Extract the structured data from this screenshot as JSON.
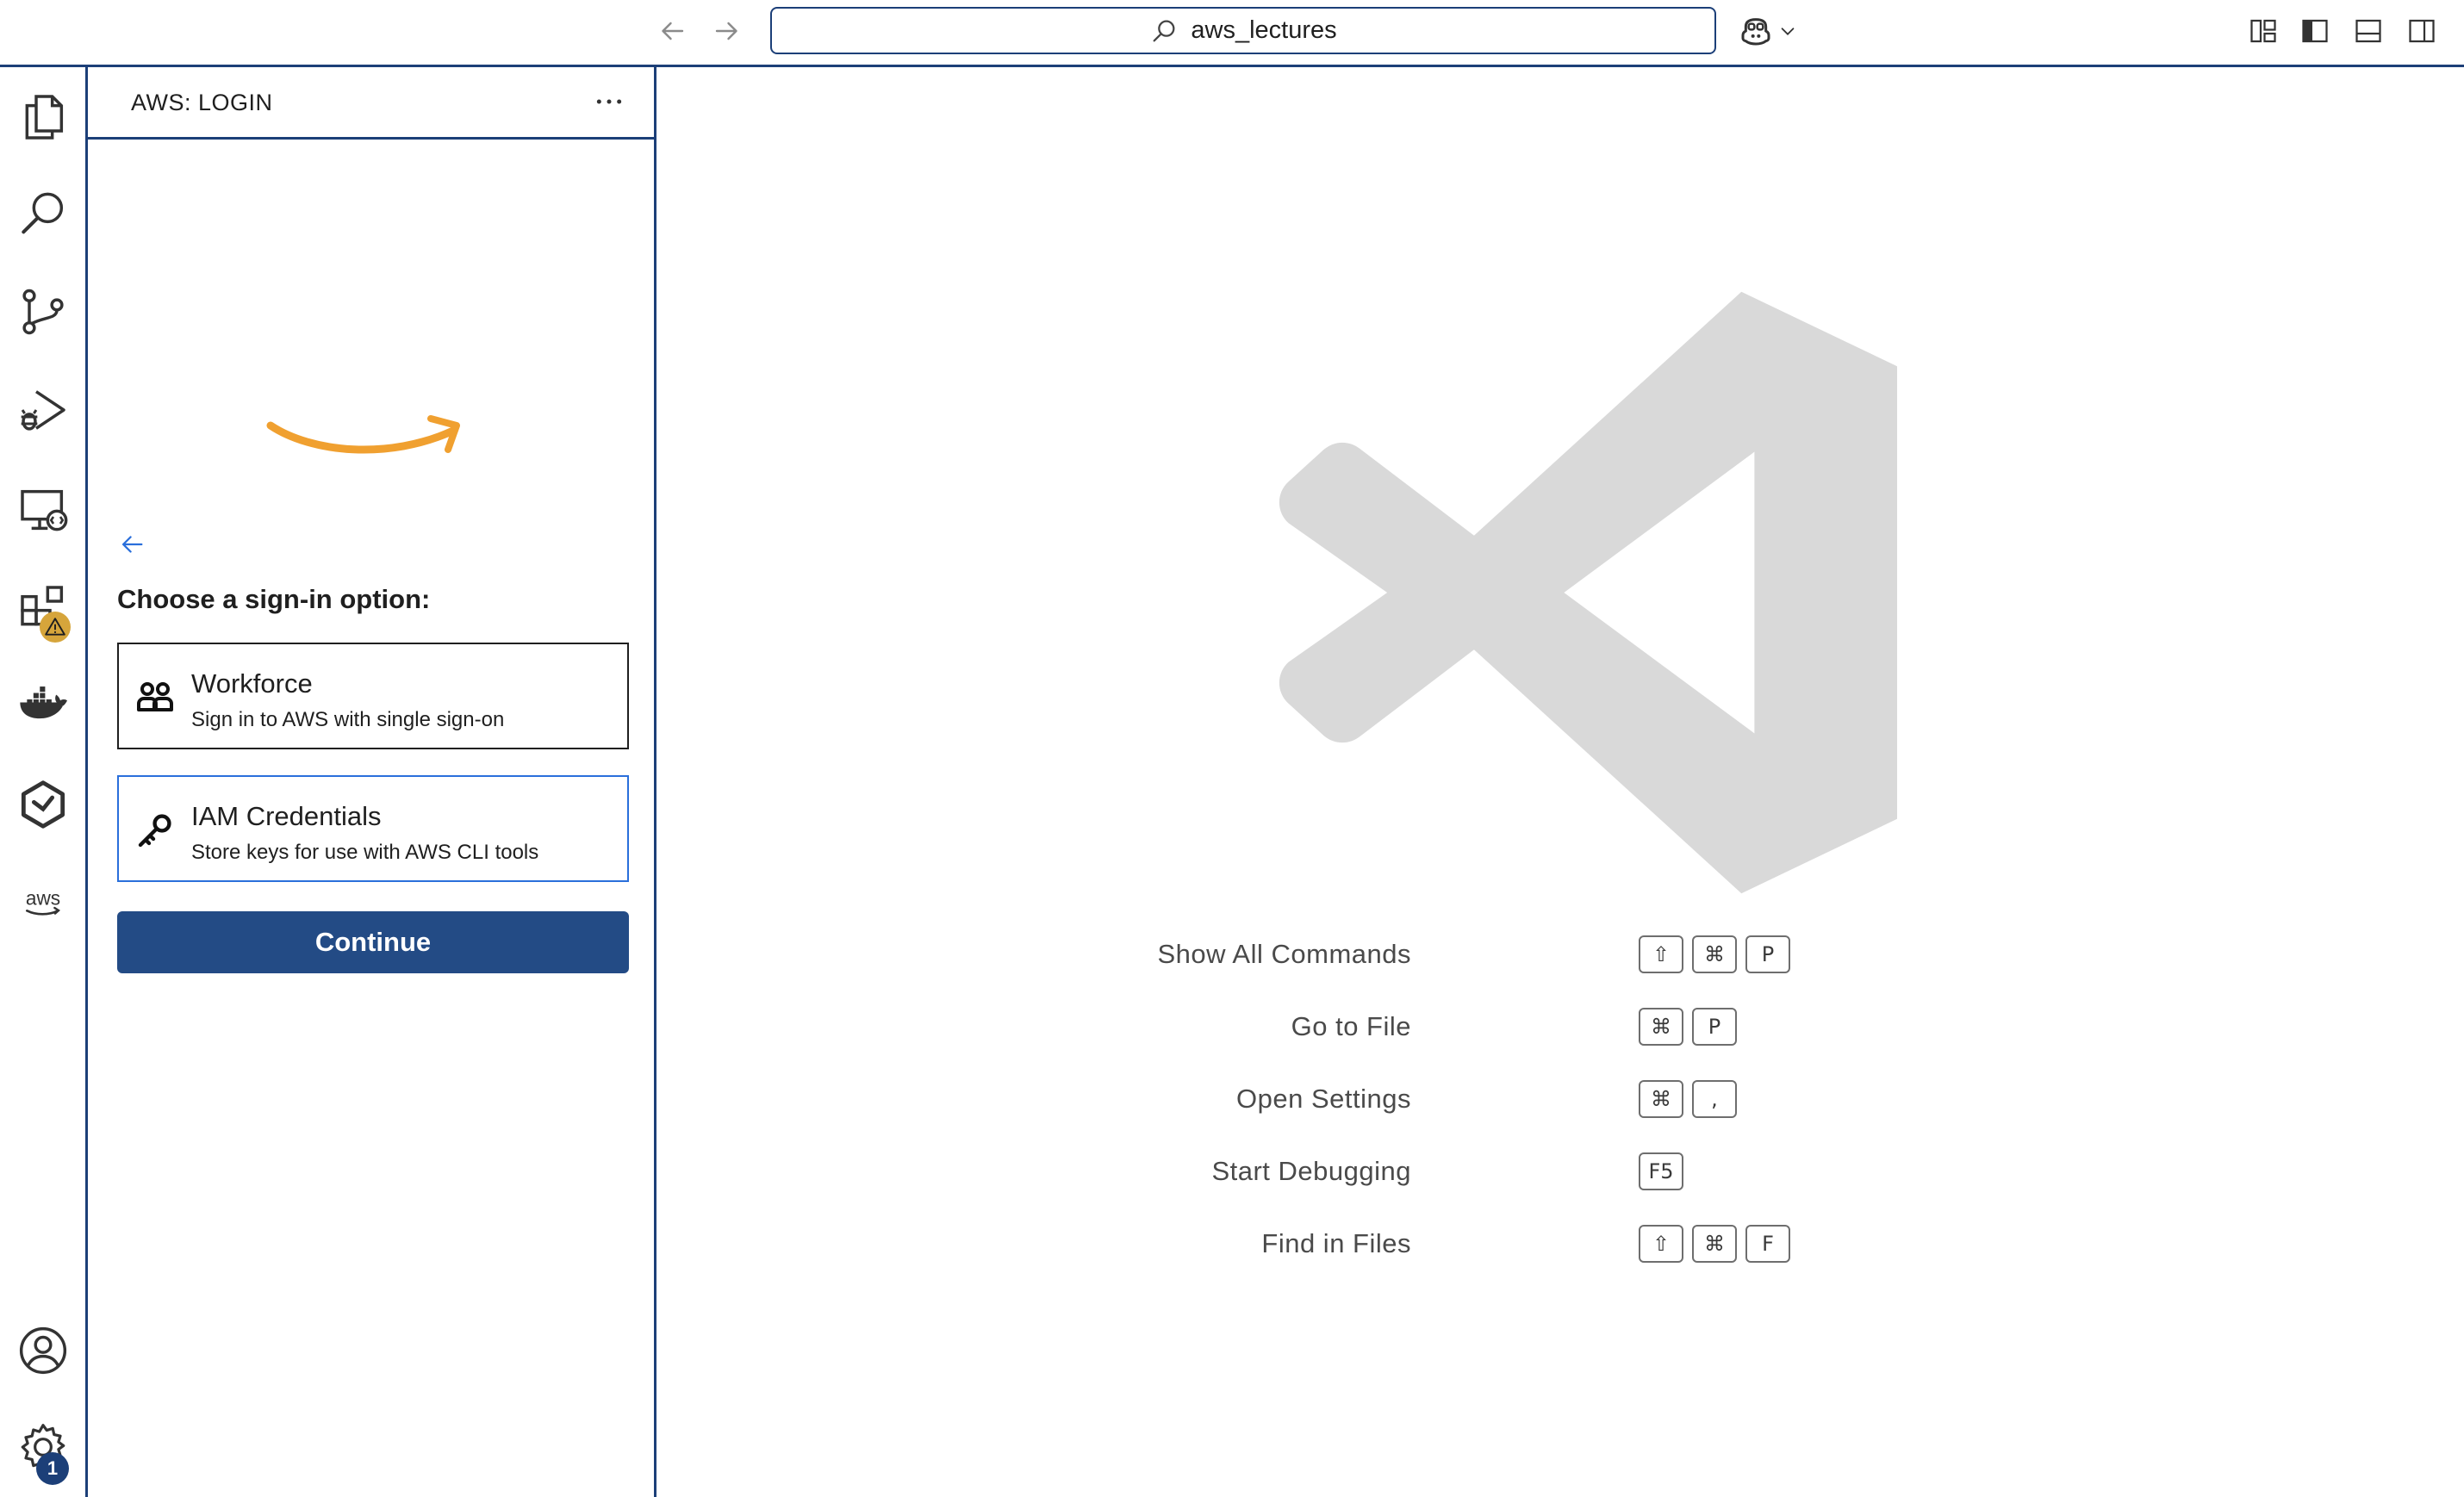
{
  "titlebar": {
    "search_text": "aws_lectures",
    "icons": [
      "arrow-left-icon",
      "arrow-right-icon",
      "search-icon",
      "copilot-icon",
      "chevron-down-icon",
      "customize-layout-icon",
      "toggle-primary-sidebar-icon",
      "toggle-panel-icon",
      "toggle-secondary-sidebar-icon"
    ]
  },
  "activitybar": {
    "items": [
      "explorer",
      "search",
      "source-control",
      "run-and-debug",
      "remote-explorer",
      "extensions",
      "docker",
      "kubernetes",
      "aws"
    ],
    "extensions_badge": "warning",
    "settings_badge": "1"
  },
  "sidebar": {
    "title": "AWS: LOGIN",
    "choose_label": "Choose a sign-in option:",
    "options": [
      {
        "title": "Workforce",
        "description": "Sign in to AWS with single sign-on",
        "icon": "users-icon",
        "selected": false
      },
      {
        "title": "IAM Credentials",
        "description": "Store keys for use with AWS CLI tools",
        "icon": "key-icon",
        "selected": true
      }
    ],
    "continue_label": "Continue",
    "colors": {
      "button": "#234b85",
      "smile": "#f0a030",
      "focus": "#2a6fdb"
    }
  },
  "editor": {
    "shortcuts": [
      {
        "label": "Show All Commands",
        "keys": [
          "⇧",
          "⌘",
          "P"
        ]
      },
      {
        "label": "Go to File",
        "keys": [
          "⌘",
          "P"
        ]
      },
      {
        "label": "Open Settings",
        "keys": [
          "⌘",
          ","
        ]
      },
      {
        "label": "Start Debugging",
        "keys": [
          "F5"
        ]
      },
      {
        "label": "Find in Files",
        "keys": [
          "⇧",
          "⌘",
          "F"
        ]
      }
    ]
  }
}
